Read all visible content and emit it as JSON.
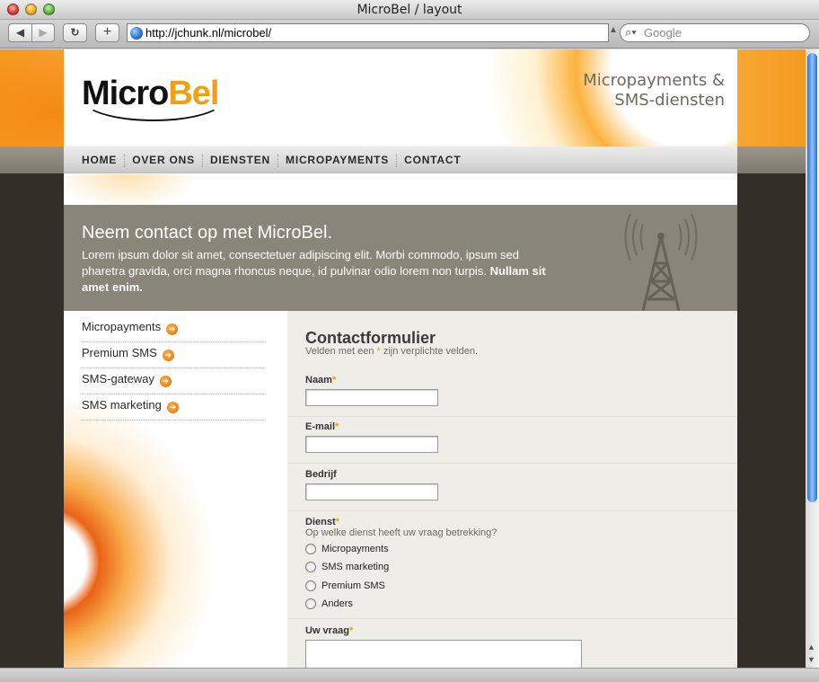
{
  "window": {
    "title": "MicroBel / layout"
  },
  "toolbar": {
    "back_icon": "◀",
    "forward_icon": "▶",
    "reload_icon": "↻",
    "add_icon": "+",
    "url": "http://jchunk.nl/microbel/",
    "search_placeholder": "Google"
  },
  "header": {
    "logo_part1": "Micro",
    "logo_part2": "Bel",
    "tagline_line1": "Micropayments &",
    "tagline_line2": "SMS-diensten"
  },
  "nav": {
    "items": [
      {
        "label": "HOME"
      },
      {
        "label": "OVER ONS"
      },
      {
        "label": "DIENSTEN"
      },
      {
        "label": "MICROPAYMENTS"
      },
      {
        "label": "CONTACT"
      }
    ]
  },
  "hero": {
    "title": "Neem contact op met MicroBel.",
    "text": "Lorem ipsum dolor sit amet, consectetuer adipiscing elit. Morbi commodo, ipsum sed pharetra gravida, orci magna rhoncus neque, id pulvinar odio lorem non turpis.",
    "strong": "Nullam sit amet enim."
  },
  "sidebar": {
    "items": [
      {
        "label": "Micropayments"
      },
      {
        "label": "Premium SMS"
      },
      {
        "label": "SMS-gateway"
      },
      {
        "label": "SMS marketing"
      }
    ]
  },
  "form": {
    "title": "Contactformulier",
    "subtitle_pre": "Velden met een ",
    "required_mark": "*",
    "subtitle_post": " zijn verplichte velden.",
    "naam_label": "Naam",
    "email_label": "E-mail",
    "bedrijf_label": "Bedrijf",
    "dienst_label": "Dienst",
    "dienst_question": "Op welke dienst heeft uw vraag betrekking?",
    "dienst_options": [
      "Micropayments",
      "SMS marketing",
      "Premium SMS",
      "Anders"
    ],
    "vraag_label": "Uw vraag"
  },
  "colors": {
    "accent_orange": "#f0a017",
    "hero_bg": "#8a857a",
    "page_dark": "#332e27"
  }
}
